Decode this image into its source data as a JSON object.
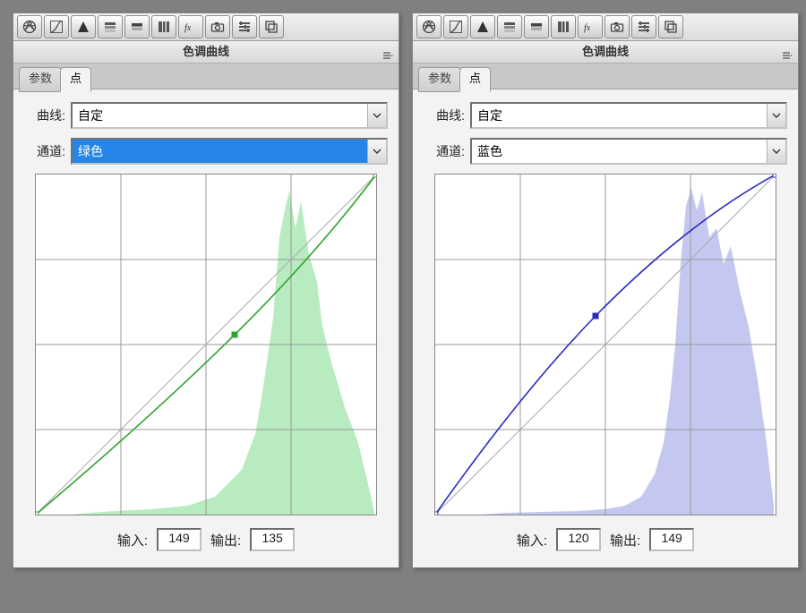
{
  "panels": [
    {
      "title": "色调曲线",
      "tabs": {
        "inactive": "参数",
        "active": "点"
      },
      "curve_label": "曲线:",
      "curve_value": "自定",
      "channel_label": "通道:",
      "channel_value": "绿色",
      "channel_selected": true,
      "input_label": "输入:",
      "input_value": "149",
      "output_label": "输出:",
      "output_value": "135"
    },
    {
      "title": "色调曲线",
      "tabs": {
        "inactive": "参数",
        "active": "点"
      },
      "curve_label": "曲线:",
      "curve_value": "自定",
      "channel_label": "通道:",
      "channel_value": "蓝色",
      "channel_selected": false,
      "input_label": "输入:",
      "input_value": "120",
      "output_label": "输出:",
      "output_value": "149"
    }
  ],
  "chart_data": [
    {
      "type": "line",
      "title": "色调曲线 – 绿色",
      "xlabel": "输入",
      "ylabel": "输出",
      "xlim": [
        0,
        255
      ],
      "ylim": [
        0,
        255
      ],
      "grid": true,
      "series": [
        {
          "name": "base",
          "x": [
            0,
            255
          ],
          "y": [
            0,
            255
          ]
        },
        {
          "name": "curve",
          "x": [
            0,
            149,
            255
          ],
          "y": [
            0,
            135,
            255
          ]
        }
      ],
      "point": {
        "x": 149,
        "y": 135
      },
      "histogram_channel": "green",
      "color": "#2fa32f"
    },
    {
      "type": "line",
      "title": "色调曲线 – 蓝色",
      "xlabel": "输入",
      "ylabel": "输出",
      "xlim": [
        0,
        255
      ],
      "ylim": [
        0,
        255
      ],
      "grid": true,
      "series": [
        {
          "name": "base",
          "x": [
            0,
            255
          ],
          "y": [
            0,
            255
          ]
        },
        {
          "name": "curve",
          "x": [
            0,
            120,
            255
          ],
          "y": [
            0,
            149,
            255
          ]
        }
      ],
      "point": {
        "x": 120,
        "y": 149
      },
      "histogram_channel": "blue",
      "color": "#2a2ac0"
    }
  ]
}
